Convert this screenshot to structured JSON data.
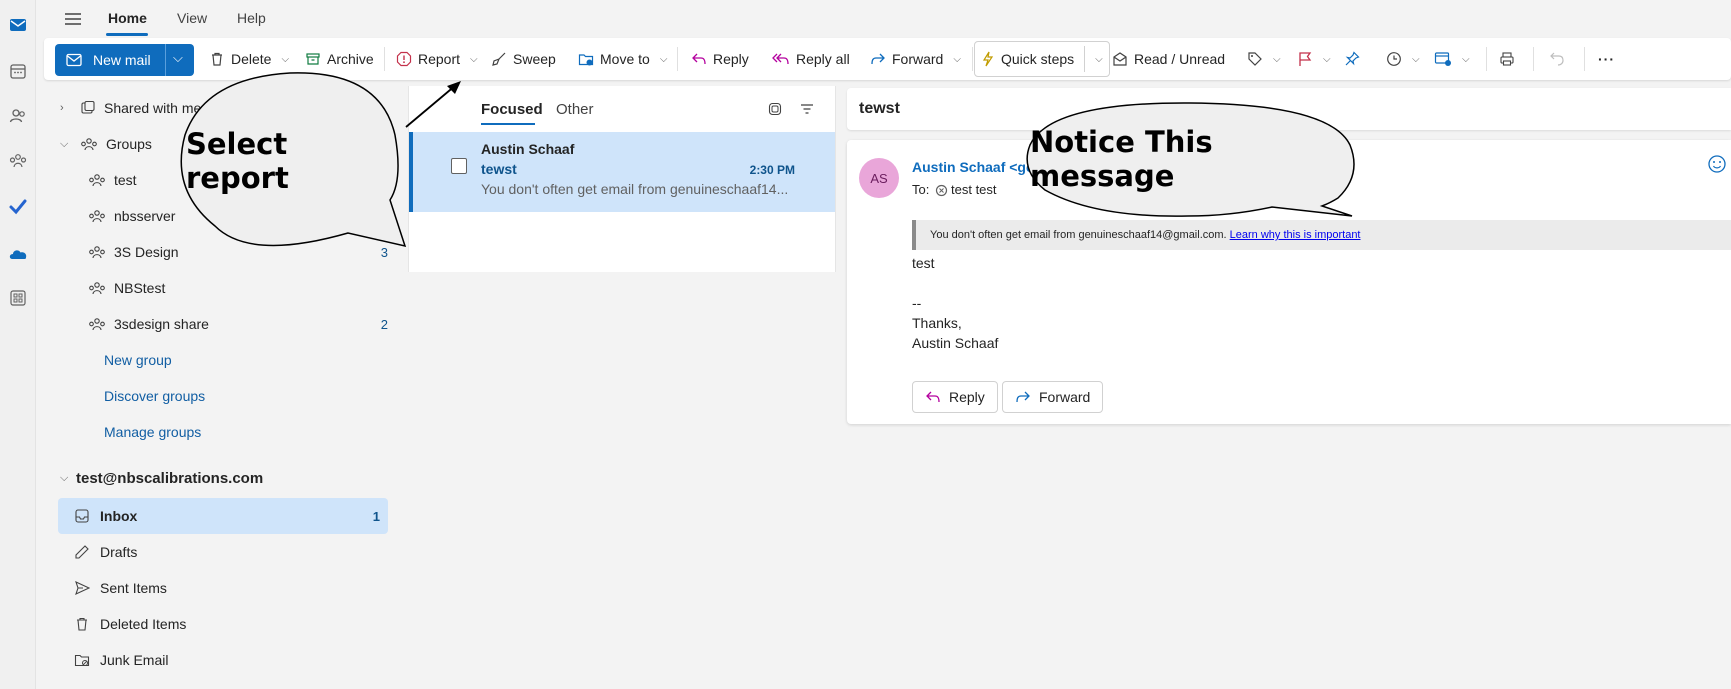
{
  "tabs": {
    "menu_icon": "hamburger-icon",
    "home": "Home",
    "view": "View",
    "help": "Help"
  },
  "ribbon": {
    "new_mail": "New mail",
    "delete": "Delete",
    "archive": "Archive",
    "report": "Report",
    "sweep": "Sweep",
    "move_to": "Move to",
    "reply": "Reply",
    "reply_all": "Reply all",
    "forward": "Forward",
    "quick_steps": "Quick steps",
    "read_unread": "Read / Unread",
    "more": "···"
  },
  "folders": {
    "shared": "Shared with me",
    "groups_header": "Groups",
    "groups": [
      {
        "label": "test",
        "count": ""
      },
      {
        "label": "nbsserver",
        "count": ""
      },
      {
        "label": "3S Design",
        "count": "3"
      },
      {
        "label": "NBStest",
        "count": ""
      },
      {
        "label": "3sdesign share",
        "count": "2"
      }
    ],
    "new_group": "New group",
    "discover_groups": "Discover groups",
    "manage_groups": "Manage groups",
    "account": "test@nbscalibrations.com",
    "mail": [
      {
        "label": "Inbox",
        "count": "1"
      },
      {
        "label": "Drafts",
        "count": ""
      },
      {
        "label": "Sent Items",
        "count": ""
      },
      {
        "label": "Deleted Items",
        "count": ""
      },
      {
        "label": "Junk Email",
        "count": ""
      }
    ]
  },
  "list": {
    "focused": "Focused",
    "other": "Other",
    "item": {
      "sender": "Austin Schaaf",
      "subject": "tewst",
      "time": "2:30 PM",
      "preview": "You don't often get email from genuineschaaf14..."
    }
  },
  "reading": {
    "subject": "tewst",
    "avatar": "AS",
    "from": "Austin Schaaf <ge",
    "to_label": "To:",
    "to_name": "test test",
    "notice": "You don't often get email from genuineschaaf14@gmail.com.",
    "notice_link": "Learn why this is important",
    "body": [
      "test",
      "",
      "--",
      "Thanks,",
      "Austin Schaaf"
    ],
    "reply_btn": "Reply",
    "forward_btn": "Forward"
  },
  "callouts": {
    "select_report": "Select report",
    "notice_message": "Notice This message"
  },
  "colors": {
    "accent": "#0f6cbd",
    "selected": "#cfe4fa",
    "link": "#115ea3",
    "avatar_bg": "#e9a6d9"
  }
}
